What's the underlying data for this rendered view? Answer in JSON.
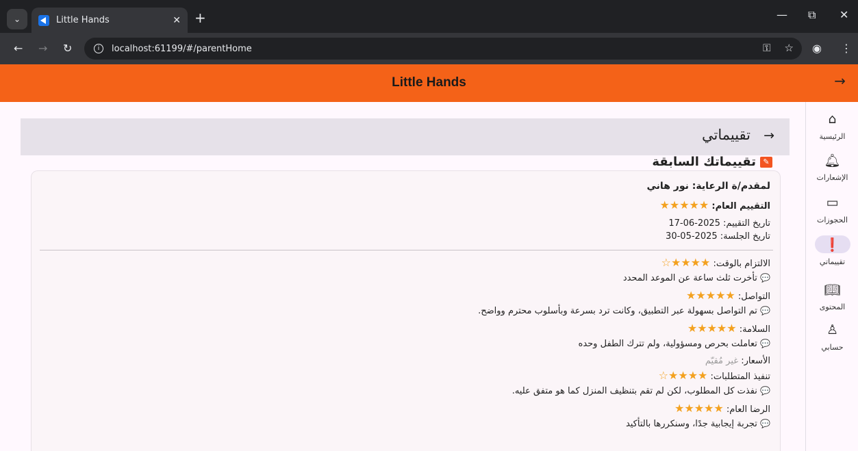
{
  "browser": {
    "tab_title": "Little Hands",
    "url": "localhost:61199/#/parentHome"
  },
  "app": {
    "title": "Little Hands",
    "accent": "#f46218"
  },
  "rail": [
    {
      "label": "الرئيسية",
      "icon": "home-icon"
    },
    {
      "label": "الإشعارات",
      "icon": "bell-icon"
    },
    {
      "label": "الحجوزات",
      "icon": "calendar-icon"
    },
    {
      "label": "تقييماتي",
      "icon": "feedback-icon",
      "active": true
    },
    {
      "label": "المحتوى",
      "icon": "book-icon"
    },
    {
      "label": "حسابي",
      "icon": "person-icon"
    }
  ],
  "page": {
    "header_title": "تقييماتي",
    "section_title": "تقييماتك السابقة"
  },
  "review": {
    "provider": "لمقدم/ة الرعاية: نور هاني",
    "overall_label": "التقييم العام:",
    "overall_stars": "★★★★★",
    "review_date": "تاريخ التقييم: 2025-06-17",
    "session_date": "تاريخ الجلسة: 2025-05-30",
    "criteria": [
      {
        "label": "الالتزام بالوقت:",
        "stars": "★★★★☆",
        "comment": "تأخرت ثلث ساعة عن الموعد المحدد"
      },
      {
        "label": "التواصل:",
        "stars": "★★★★★",
        "comment": "تم التواصل بسهولة عبر التطبيق، وكانت ترد بسرعة وبأسلوب محترم وواضح."
      },
      {
        "label": "السلامة:",
        "stars": "★★★★★",
        "comment": "تعاملت بحرص ومسؤولية، ولم تترك الطفل وحده"
      },
      {
        "label": "الأسعار:",
        "unrated": "غير مُقيّم"
      },
      {
        "label": "تنفيذ المتطلبات:",
        "stars": "★★★★☆",
        "comment": "نفذت كل المطلوب، لكن لم تقم بتنظيف المنزل كما هو متفق عليه."
      },
      {
        "label": "الرضا العام:",
        "stars": "★★★★★",
        "comment": "تجربة إيجابية جدًا، وسنكررها بالتأكيد"
      }
    ]
  }
}
